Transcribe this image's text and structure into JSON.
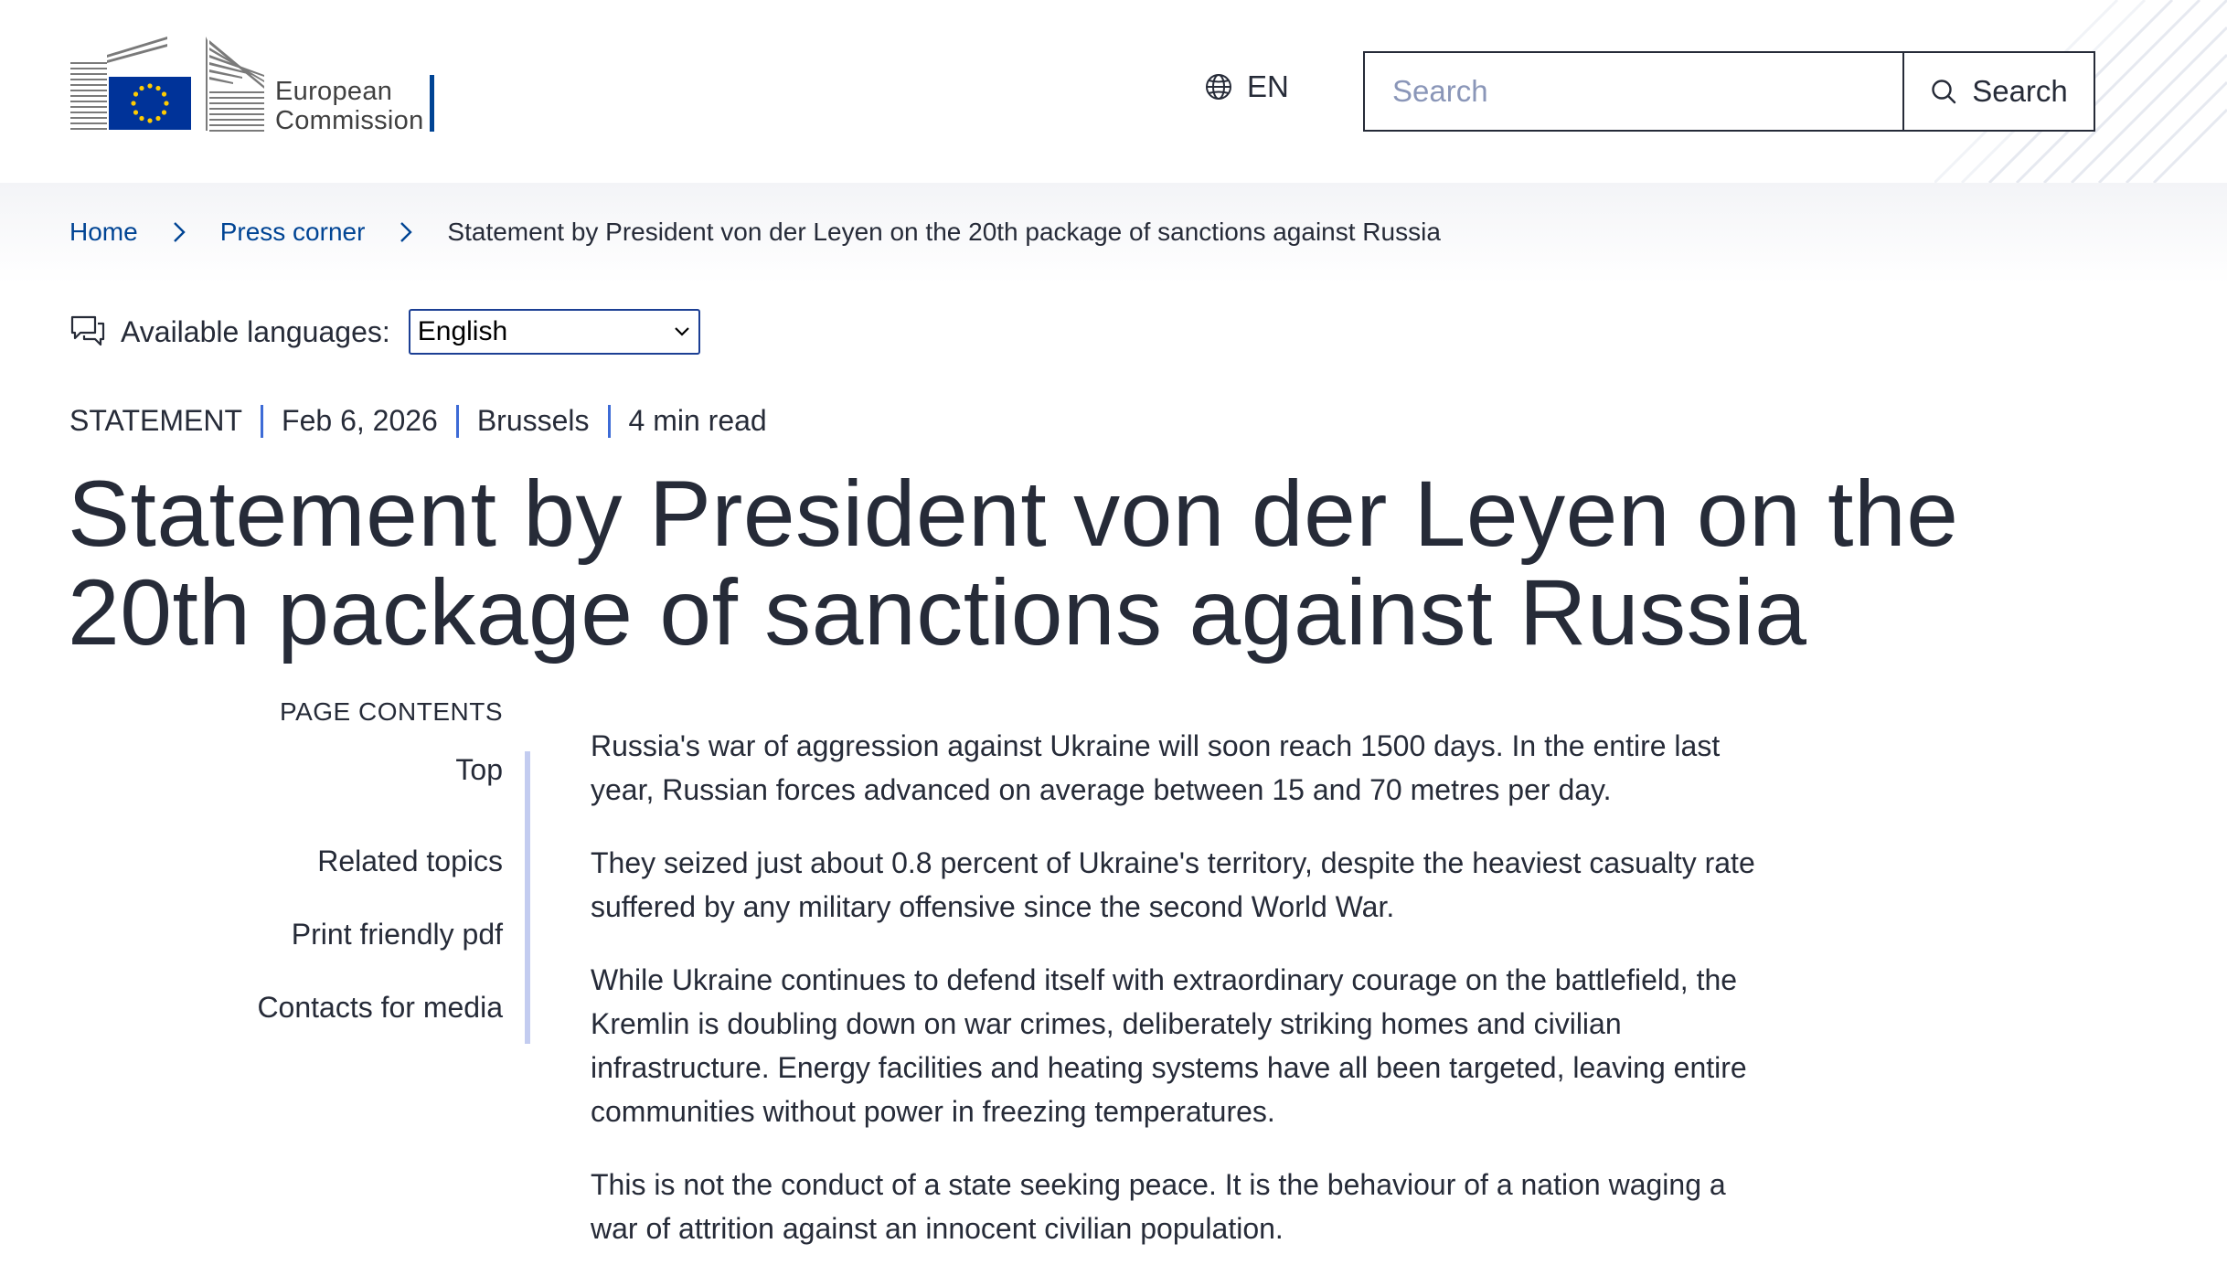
{
  "header": {
    "logo_line1": "European",
    "logo_line2": "Commission",
    "language_code": "EN",
    "search_placeholder": "Search",
    "search_button_label": "Search"
  },
  "breadcrumb": {
    "items": [
      "Home",
      "Press corner"
    ],
    "current": "Statement by President von der Leyen on the 20th package of sanctions against Russia"
  },
  "languages": {
    "label": "Available languages:",
    "selected": "English"
  },
  "meta": {
    "type": "STATEMENT",
    "date": "Feb 6, 2026",
    "location": "Brussels",
    "read_time": "4 min read"
  },
  "title_line1": "Statement by President von der Leyen on the",
  "title_line2": "20th package of sanctions against Russia",
  "page_contents": {
    "heading": "PAGE CONTENTS",
    "items": [
      "Top",
      "Related topics",
      "Print friendly pdf",
      "Contacts for media"
    ]
  },
  "body": {
    "paragraphs": [
      "Russia's war of aggression against Ukraine will soon reach 1500 days. In the entire last year, Russian forces advanced on average between 15 and 70 metres per day.",
      "They seized just about 0.8 percent of Ukraine's territory, despite the heaviest casualty rate suffered by any military offensive since the second World War.",
      "While Ukraine continues to defend itself with extraordinary courage on the battlefield, the Kremlin is doubling down on war crimes, deliberately striking homes and civilian infrastructure. Energy facilities and heating systems have all been targeted, leaving entire communities without power in freezing temperatures.",
      "This is not the conduct of a state seeking peace. It is the behaviour of a nation waging a war of attrition against an innocent civilian population."
    ]
  },
  "colors": {
    "link": "#004494",
    "text": "#262b38",
    "accent": "#3d6bd6",
    "eu_blue": "#003399",
    "eu_yellow": "#ffcc00"
  }
}
